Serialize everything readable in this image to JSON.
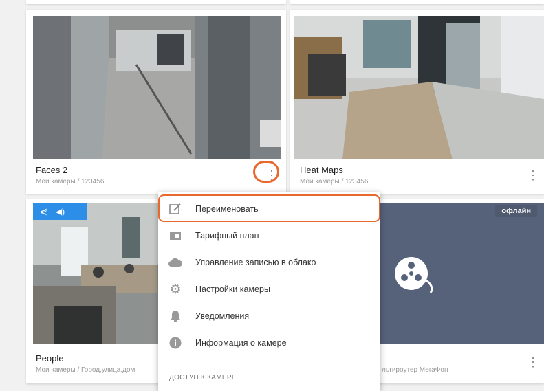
{
  "cameras": [
    {
      "title": "Faces 2",
      "path": "Мои камеры / 123456"
    },
    {
      "title": "Heat Maps",
      "path": "Мои камеры / 123456"
    },
    {
      "title": "People",
      "path": "Мои камеры / Город,улица,дом"
    },
    {
      "title": "",
      "path": "льтироутер МегаФон",
      "badge": "офлайн"
    }
  ],
  "menu": {
    "items": [
      {
        "label": "Переименовать",
        "icon": "edit-icon"
      },
      {
        "label": "Тарифный план",
        "icon": "wallet-icon"
      },
      {
        "label": "Управление записью в облако",
        "icon": "cloud-icon"
      },
      {
        "label": "Настройки камеры",
        "icon": "gear-icon"
      },
      {
        "label": "Уведомления",
        "icon": "bell-icon"
      },
      {
        "label": "Информация о камере",
        "icon": "info-icon"
      }
    ],
    "section_label": "ДОСТУП К КАМЕРЕ"
  },
  "colors": {
    "accent_highlight": "#e9682d",
    "toolbar_blue": "#2d8ee8",
    "offline_bg": "#4f5a6f"
  }
}
